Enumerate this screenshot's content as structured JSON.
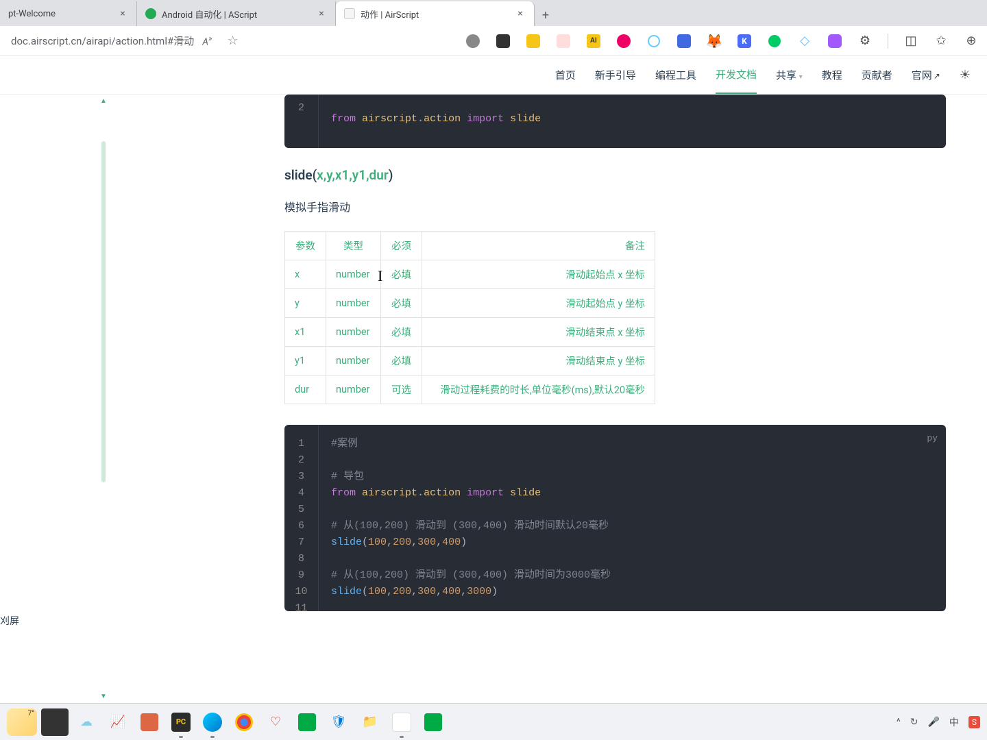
{
  "tabs": {
    "t0": {
      "title": "pt-Welcome"
    },
    "t1": {
      "title": "Android 自动化 | AScript"
    },
    "t2": {
      "title": "动作 | AirScript"
    }
  },
  "url": "doc.airscript.cn/airapi/action.html#滑动",
  "nav": {
    "home": "首页",
    "guide": "新手引导",
    "tools": "编程工具",
    "docs": "开发文档",
    "share": "共享",
    "tutorial": "教程",
    "contrib": "贡献者",
    "site": "官网"
  },
  "sidebar": {
    "screenshot": "刈屏"
  },
  "code1": {
    "line2": "from airscript.action import slide"
  },
  "sig": {
    "name": "slide",
    "args": "x,y,x1,y1,dur"
  },
  "desc": "模拟手指滑动",
  "table": {
    "h_param": "参数",
    "h_type": "类型",
    "h_req": "必须",
    "h_note": "备注",
    "r1": {
      "p": "x",
      "t": "number",
      "r": "必填",
      "n": "滑动起始点 x 坐标"
    },
    "r2": {
      "p": "y",
      "t": "number",
      "r": "必填",
      "n": "滑动起始点 y 坐标"
    },
    "r3": {
      "p": "x1",
      "t": "number",
      "r": "必填",
      "n": "滑动结束点 x 坐标"
    },
    "r4": {
      "p": "y1",
      "t": "number",
      "r": "必填",
      "n": "滑动结束点 y 坐标"
    },
    "r5": {
      "p": "dur",
      "t": "number",
      "r": "可选",
      "n": "滑动过程耗费的时长,单位毫秒(ms),默认20毫秒"
    }
  },
  "code2": {
    "lang": "py",
    "l1": "#案例",
    "l3": "# 导包",
    "l4": "from airscript.action import slide",
    "l6": "# 从(100,200) 滑动到 (300,400) 滑动时间默认20毫秒",
    "l7": "slide(100,200,300,400)",
    "l9": "# 从(100,200) 滑动到 (300,400) 滑动时间为3000毫秒",
    "l10": "slide(100,200,300,400,3000)"
  },
  "weather_temp": "7°",
  "tray": {
    "ime": "中"
  },
  "chart_data": null
}
